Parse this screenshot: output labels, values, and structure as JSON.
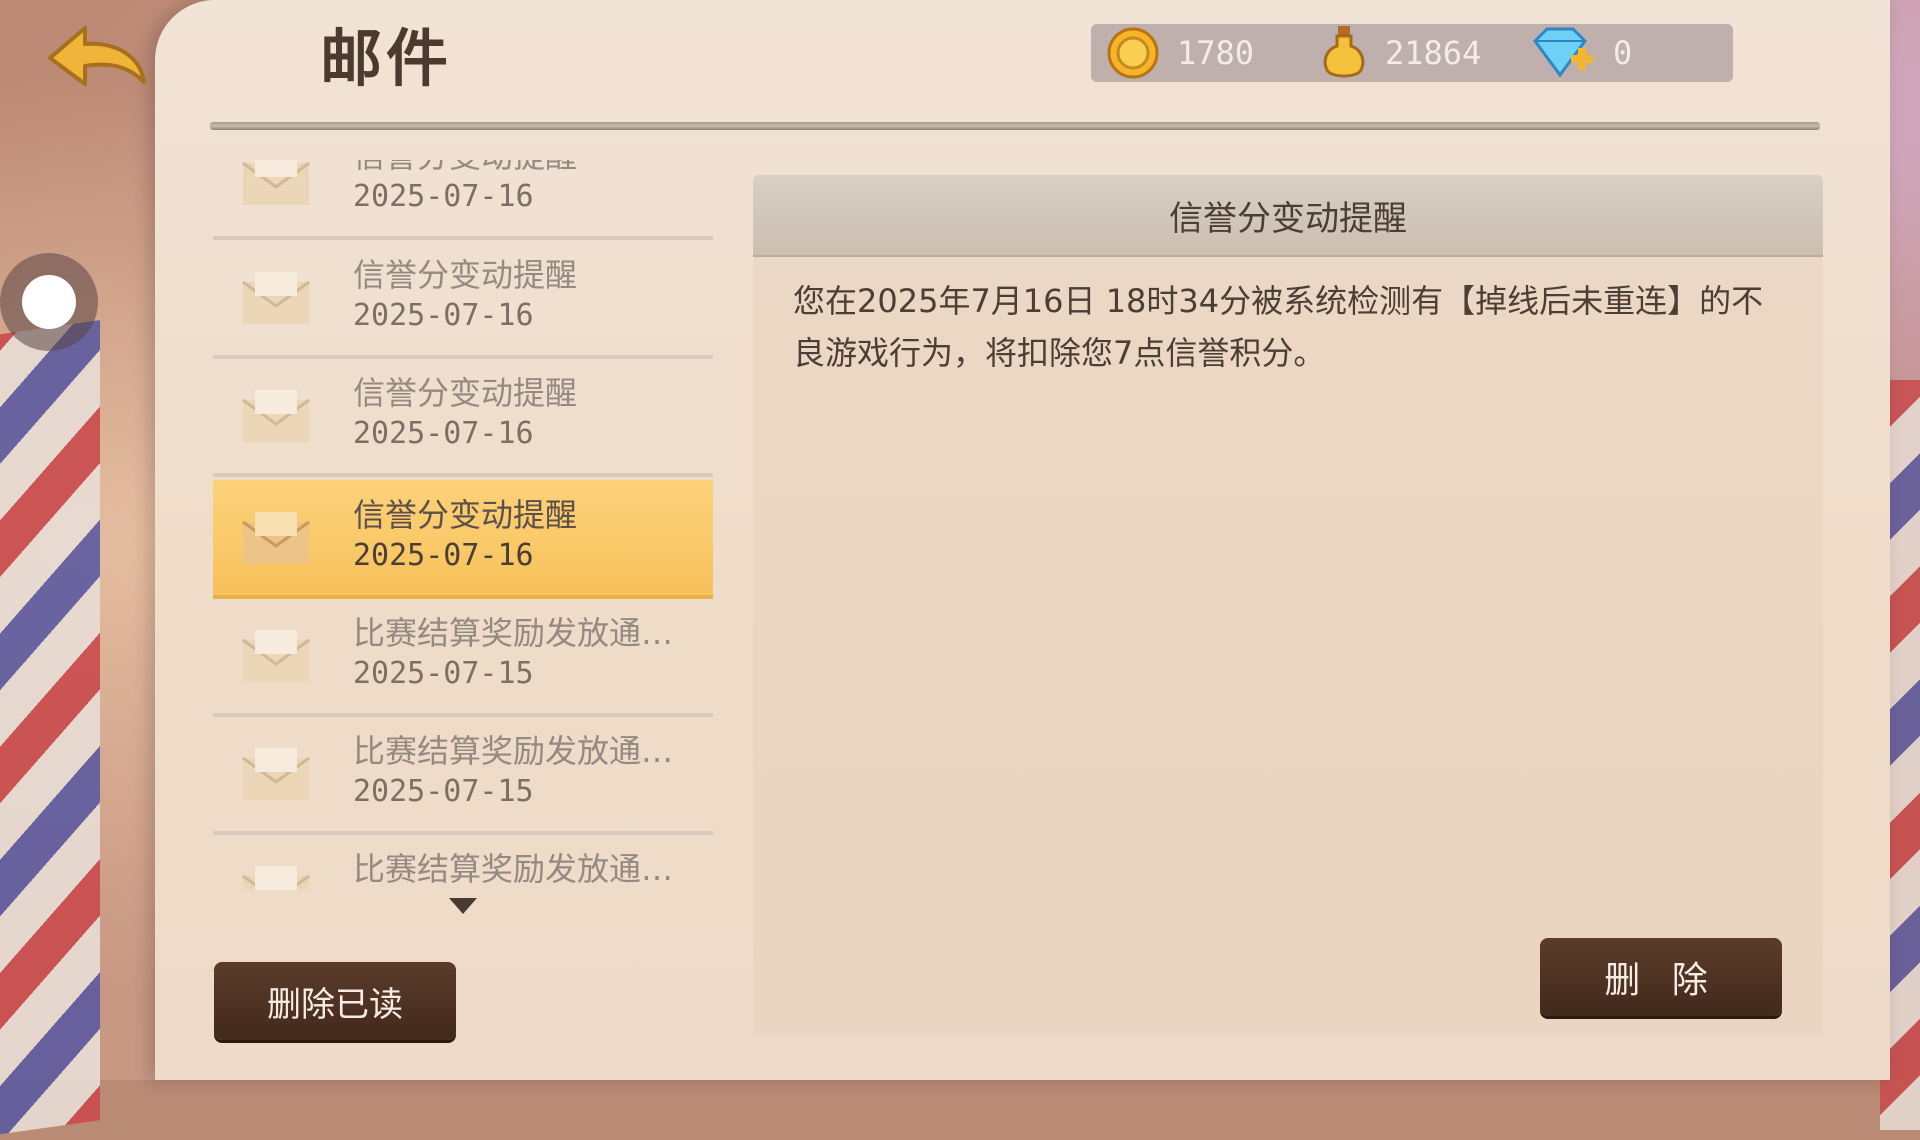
{
  "header": {
    "title": "邮件",
    "back_icon": "back-arrow-icon"
  },
  "currencies": [
    {
      "icon": "gold-coin-icon",
      "value": "1780"
    },
    {
      "icon": "potion-flask-icon",
      "value": "21864"
    },
    {
      "icon": "diamond-plus-icon",
      "value": "0"
    }
  ],
  "mail_list": {
    "items": [
      {
        "subject": "信誉分变动提醒",
        "date": "2025-07-16",
        "selected": false
      },
      {
        "subject": "信誉分变动提醒",
        "date": "2025-07-16",
        "selected": false
      },
      {
        "subject": "信誉分变动提醒",
        "date": "2025-07-16",
        "selected": false
      },
      {
        "subject": "信誉分变动提醒",
        "date": "2025-07-16",
        "selected": true
      },
      {
        "subject": "比赛结算奖励发放通…",
        "date": "2025-07-15",
        "selected": false
      },
      {
        "subject": "比赛结算奖励发放通…",
        "date": "2025-07-15",
        "selected": false
      },
      {
        "subject": "比赛结算奖励发放通…",
        "date": "",
        "selected": false
      }
    ]
  },
  "buttons": {
    "delete_read": "删除已读",
    "delete": "删 除"
  },
  "detail": {
    "title": "信誉分变动提醒",
    "body": "您在2025年7月16日 18时34分被系统检测有【掉线后未重连】的不良游戏行为，将扣除您7点信誉积分。"
  },
  "colors": {
    "selected_row": "#f7c15b",
    "button_dark": "#4a2f20",
    "paper": "#efdcc8"
  }
}
